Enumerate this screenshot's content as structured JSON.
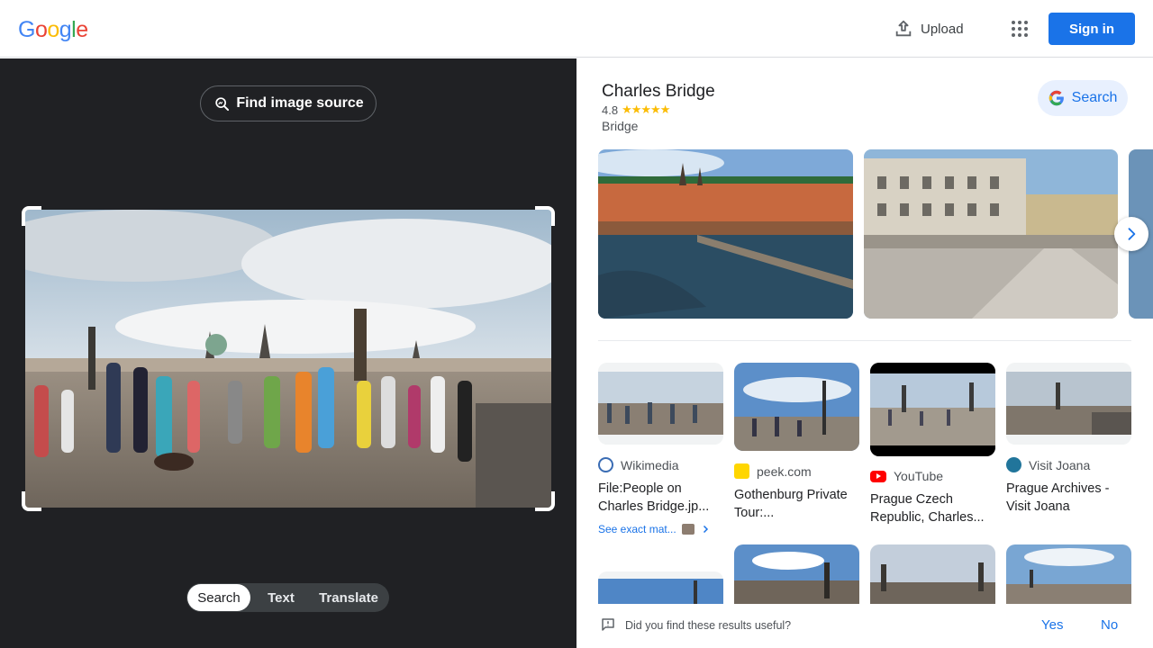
{
  "header": {
    "logo_letters": [
      {
        "ch": "G",
        "color": "#4285f4"
      },
      {
        "ch": "o",
        "color": "#ea4335"
      },
      {
        "ch": "o",
        "color": "#fbbc05"
      },
      {
        "ch": "g",
        "color": "#4285f4"
      },
      {
        "ch": "l",
        "color": "#34a853"
      },
      {
        "ch": "e",
        "color": "#ea4335"
      }
    ],
    "upload_label": "Upload",
    "signin_label": "Sign in"
  },
  "left_panel": {
    "find_source_label": "Find image source",
    "modes": [
      "Search",
      "Text",
      "Translate"
    ],
    "active_mode": "Search"
  },
  "knowledge_panel": {
    "title": "Charles Bridge",
    "rating": "4.8",
    "stars": "★★★★★",
    "type": "Bridge",
    "search_label": "Search"
  },
  "results": [
    {
      "source": "Wikimedia",
      "title": "File:People on Charles Bridge.jp...",
      "exact_label": "See exact mat..."
    },
    {
      "source": "peek.com",
      "title": "Gothenburg Private Tour:..."
    },
    {
      "source": "YouTube",
      "title": "Prague Czech Republic, Charles..."
    },
    {
      "source": "Visit Joana",
      "title": "Prague Archives - Visit Joana"
    }
  ],
  "feedback": {
    "question": "Did you find these results useful?",
    "yes_label": "Yes",
    "no_label": "No"
  },
  "colors": {
    "accent": "#1a73e8",
    "dark_panel": "#202124",
    "star": "#fbbc04"
  }
}
